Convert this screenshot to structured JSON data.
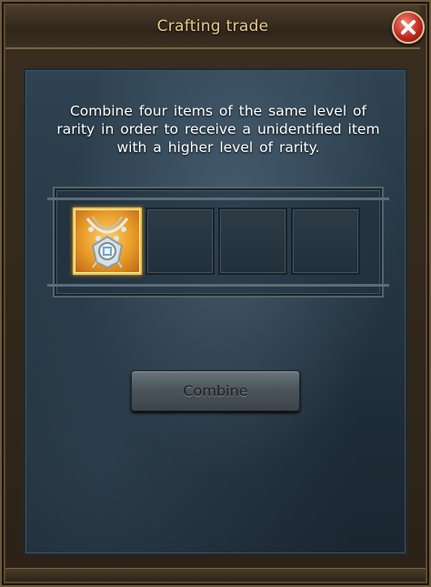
{
  "window": {
    "title": "Crafting trade",
    "close_icon": "close-icon"
  },
  "description": "Combine four items of the same level of rarity in order to receive a unidentified item with a higher level of rarity.",
  "slots": [
    {
      "filled": true,
      "item_icon": "necklace-icon"
    },
    {
      "filled": false
    },
    {
      "filled": false
    },
    {
      "filled": false
    }
  ],
  "actions": {
    "combine_label": "Combine",
    "combine_enabled": false
  },
  "colors": {
    "title_text": "#e8c98a",
    "filled_slot": "#e79a26",
    "panel": "#2f4352"
  }
}
